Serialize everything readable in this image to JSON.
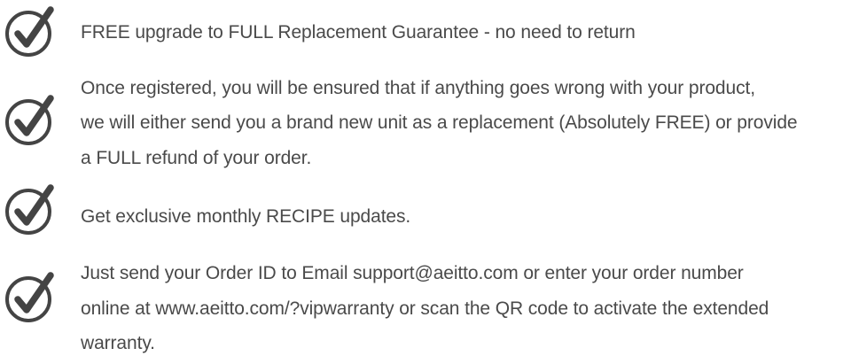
{
  "accent_color": "#444444",
  "icon": "check-circle-icon",
  "benefits": [
    {
      "lines": [
        "FREE upgrade to FULL Replacement Guarantee - no need to return"
      ]
    },
    {
      "lines": [
        "Once registered, you will be ensured that if anything goes wrong with your product,",
        "we will either send you a brand new unit as a replacement (Absolutely FREE) or provide",
        "a FULL refund of your order."
      ]
    },
    {
      "lines": [
        "Get exclusive monthly RECIPE updates."
      ]
    },
    {
      "lines": [
        "Just send your Order ID to Email support@aeitto.com or enter your order number",
        "online at www.aeitto.com/?vipwarranty or scan the QR code to activate the extended",
        "warranty."
      ]
    }
  ]
}
